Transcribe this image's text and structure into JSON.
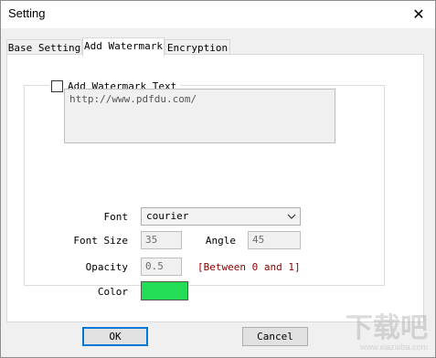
{
  "window": {
    "title": "Setting",
    "close_glyph": "✕"
  },
  "tabs": [
    {
      "label": "Base Setting",
      "active": false
    },
    {
      "label": "Add Watermark",
      "active": true
    },
    {
      "label": "Encryption",
      "active": false
    }
  ],
  "watermark": {
    "checkbox_label": "Add Watermark Text",
    "checked": false,
    "text_value": "http://www.pdfdu.com/",
    "font_label": "Font",
    "font_value": "courier",
    "font_size_label": "Font Size",
    "font_size_value": "35",
    "angle_label": "Angle",
    "angle_value": "45",
    "opacity_label": "Opacity",
    "opacity_value": "0.5",
    "opacity_hint": "[Between 0 and 1]",
    "color_label": "Color",
    "color_value": "#22dd55"
  },
  "buttons": {
    "ok_label": "OK",
    "cancel_label": "Cancel"
  },
  "site_watermark": {
    "main_text": "下载吧",
    "url_text": "www.xiazaiba.com"
  }
}
